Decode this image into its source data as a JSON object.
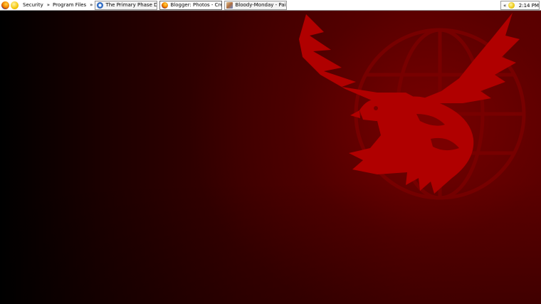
{
  "taskbar": {
    "quicklaunch": [
      {
        "icon": "firefox-icon"
      },
      {
        "icon": "smiley-icon"
      }
    ],
    "toolbars": [
      {
        "label": "Security"
      },
      {
        "label": "Program Files"
      }
    ],
    "chevron": "»",
    "tasks": [
      {
        "label": "The Primary Phase Disc ...",
        "icon": "web-document-icon",
        "active": false
      },
      {
        "label": "Blogger: Photos - Create ...",
        "icon": "firefox-icon",
        "active": true
      },
      {
        "label": "Bloody-Monday - Paint",
        "icon": "paint-icon",
        "active": false
      }
    ]
  },
  "tray": {
    "chevron": "«",
    "icon": "messenger-status-icon",
    "clock": "2:14 PM"
  },
  "desktop": {
    "wallpaper": "red-eagle-globe-emblem",
    "colors": {
      "background": "#3a0000",
      "emblem": "#b00000"
    }
  }
}
